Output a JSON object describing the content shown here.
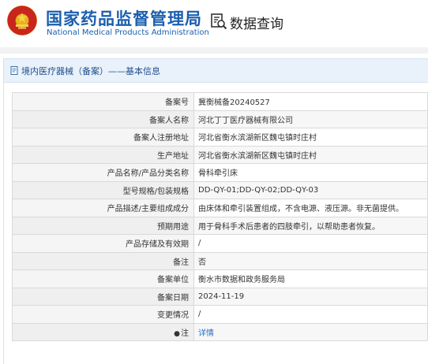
{
  "header": {
    "agency_cn": "国家药品监督管理局",
    "agency_en": "National Medical Products Administration",
    "query_title": "数据查询",
    "emblem_icon": "national-emblem-icon",
    "query_icon": "document-search-icon",
    "brand_color": "#1a5fae"
  },
  "section": {
    "title": "境内医疗器械（备案）——基本信息",
    "icon": "document-icon"
  },
  "rows": [
    {
      "label": "备案号",
      "value": "冀衡械备20240527"
    },
    {
      "label": "备案人名称",
      "value": "河北丁丁医疗器械有限公司"
    },
    {
      "label": "备案人注册地址",
      "value": "河北省衡水滨湖新区魏屯镇时庄村"
    },
    {
      "label": "生产地址",
      "value": "河北省衡水滨湖新区魏屯镇时庄村"
    },
    {
      "label": "产品名称/产品分类名称",
      "value": "骨科牵引床"
    },
    {
      "label": "型号规格/包装规格",
      "value": "DD-QY-01;DD-QY-02;DD-QY-03"
    },
    {
      "label": "产品描述/主要组成成分",
      "value": "由床体和牵引装置组成，不含电源、液压源。非无菌提供。"
    },
    {
      "label": "预期用途",
      "value": "用于骨科手术后患者的四肢牵引，以帮助患者恢复。"
    },
    {
      "label": "产品存储及有效期",
      "value": "/"
    },
    {
      "label": "备注",
      "value": "否"
    },
    {
      "label": "备案单位",
      "value": "衡水市数据和政务服务局"
    },
    {
      "label": "备案日期",
      "value": "2024-11-19"
    },
    {
      "label": "变更情况",
      "value": "/"
    },
    {
      "label": "注",
      "value": "详情",
      "is_link": true,
      "label_icon": "info-dot-icon"
    }
  ]
}
